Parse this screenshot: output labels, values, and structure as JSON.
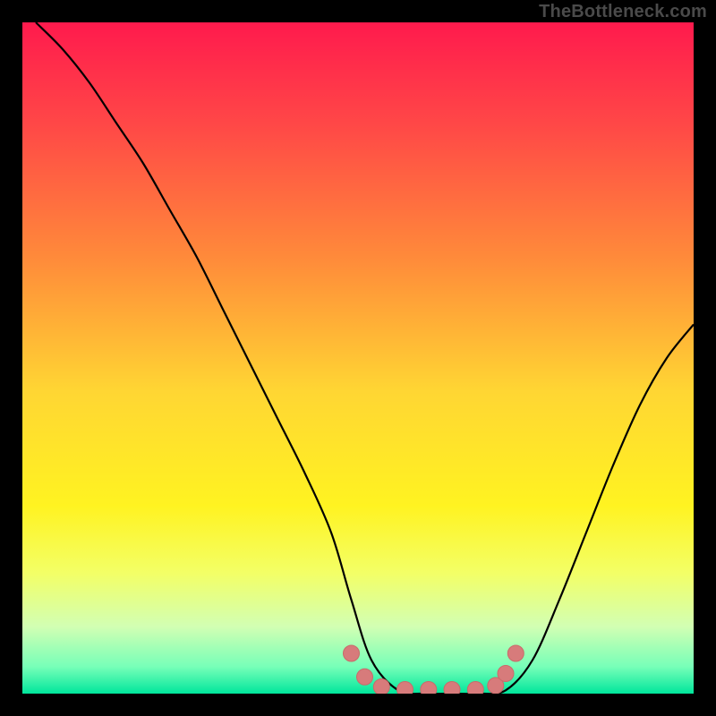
{
  "watermark": "TheBottleneck.com",
  "colors": {
    "bg": "#000000",
    "curve": "#000000",
    "marker_fill": "#d77b7b",
    "marker_stroke": "#c96a6a"
  },
  "chart_data": {
    "type": "line",
    "title": "",
    "xlabel": "",
    "ylabel": "",
    "xlim": [
      0,
      100
    ],
    "ylim": [
      0,
      100
    ],
    "gradient_stops": [
      {
        "pos": 0.0,
        "color": "#ff1a4d"
      },
      {
        "pos": 0.15,
        "color": "#ff4747"
      },
      {
        "pos": 0.35,
        "color": "#ff8a3a"
      },
      {
        "pos": 0.55,
        "color": "#ffd633"
      },
      {
        "pos": 0.72,
        "color": "#fff321"
      },
      {
        "pos": 0.82,
        "color": "#f3ff66"
      },
      {
        "pos": 0.9,
        "color": "#d2ffb3"
      },
      {
        "pos": 0.96,
        "color": "#77ffb8"
      },
      {
        "pos": 1.0,
        "color": "#00e69c"
      }
    ],
    "series": [
      {
        "name": "bottleneck-curve",
        "x": [
          2,
          6,
          10,
          14,
          18,
          22,
          26,
          30,
          34,
          38,
          42,
          46,
          49,
          52,
          56,
          60,
          64,
          68,
          72,
          76,
          80,
          84,
          88,
          92,
          96,
          100
        ],
        "y": [
          100,
          96,
          91,
          85,
          79,
          72,
          65,
          57,
          49,
          41,
          33,
          24,
          14,
          5,
          0.5,
          0,
          0,
          0,
          0.5,
          5,
          14,
          24,
          34,
          43,
          50,
          55
        ]
      }
    ],
    "markers": {
      "name": "highlight-dots",
      "x": [
        49,
        51,
        53.5,
        57,
        60.5,
        64,
        67.5,
        70.5,
        72,
        73.5
      ],
      "y": [
        6,
        2.5,
        1,
        0.6,
        0.6,
        0.6,
        0.6,
        1.2,
        3,
        6
      ]
    }
  }
}
